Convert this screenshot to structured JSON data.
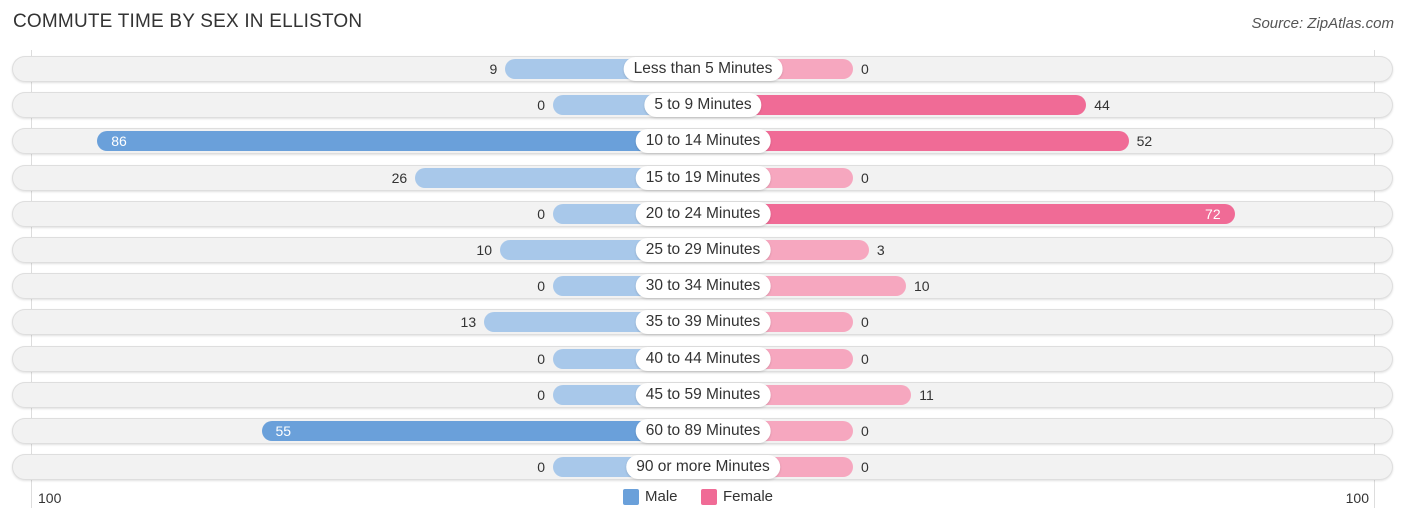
{
  "title": "COMMUTE TIME BY SEX IN ELLISTON",
  "source": "Source: ZipAtlas.com",
  "colors": {
    "male": "#a8c8ea",
    "male_strong": "#6aa0da",
    "female": "#f6a7bf",
    "female_strong": "#f06b96"
  },
  "chart_data": {
    "type": "bar",
    "orientation": "horizontal-diverging",
    "title": "COMMUTE TIME BY SEX IN ELLISTON",
    "categories": [
      "Less than 5 Minutes",
      "5 to 9 Minutes",
      "10 to 14 Minutes",
      "15 to 19 Minutes",
      "20 to 24 Minutes",
      "25 to 29 Minutes",
      "30 to 34 Minutes",
      "35 to 39 Minutes",
      "40 to 44 Minutes",
      "45 to 59 Minutes",
      "60 to 89 Minutes",
      "90 or more Minutes"
    ],
    "series": [
      {
        "name": "Male",
        "values": [
          9,
          0,
          86,
          26,
          0,
          10,
          0,
          13,
          0,
          0,
          55,
          0
        ]
      },
      {
        "name": "Female",
        "values": [
          0,
          44,
          52,
          0,
          72,
          3,
          10,
          0,
          0,
          11,
          0,
          0
        ]
      }
    ],
    "axis": {
      "left_label": "100",
      "right_label": "100",
      "range": [
        0,
        100
      ]
    },
    "legend": {
      "position": "bottom-center",
      "items": [
        "Male",
        "Female"
      ]
    }
  }
}
